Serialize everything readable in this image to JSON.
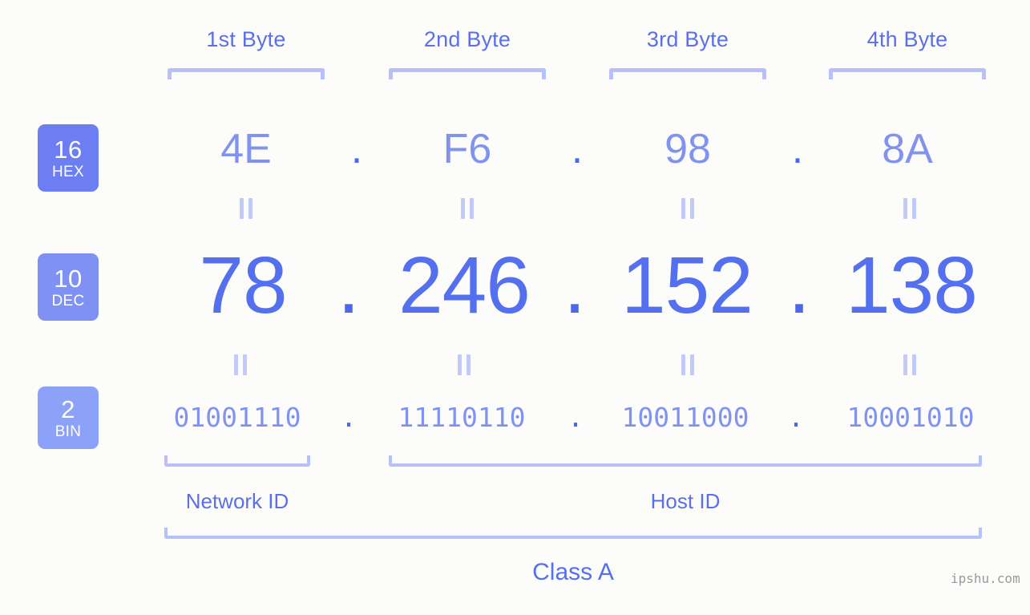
{
  "meta": {
    "watermark": "ipshu.com",
    "background_color": "#fcfdfa",
    "accent_color": "#5570ee",
    "bracket_color": "#b7c0fb"
  },
  "byte_headers": [
    {
      "label": "1st Byte"
    },
    {
      "label": "2nd Byte"
    },
    {
      "label": "3rd Byte"
    },
    {
      "label": "4th Byte"
    }
  ],
  "rows": {
    "hex": {
      "badge_number": "16",
      "badge_system": "HEX",
      "badge_color": "#6c7ef1",
      "separator": ".",
      "values": [
        "4E",
        "F6",
        "98",
        "8A"
      ]
    },
    "dec": {
      "badge_number": "10",
      "badge_system": "DEC",
      "badge_color": "#7f92f3",
      "separator": ".",
      "values": [
        "78",
        "246",
        "152",
        "138"
      ]
    },
    "bin": {
      "badge_number": "2",
      "badge_system": "BIN",
      "badge_color": "#8ba2f8",
      "separator": ".",
      "values": [
        "01001110",
        "11110110",
        "10011000",
        "10001010"
      ]
    }
  },
  "equals_symbol": "||",
  "segments": {
    "network_id": "Network ID",
    "host_id": "Host ID"
  },
  "class": {
    "label": "Class A"
  }
}
